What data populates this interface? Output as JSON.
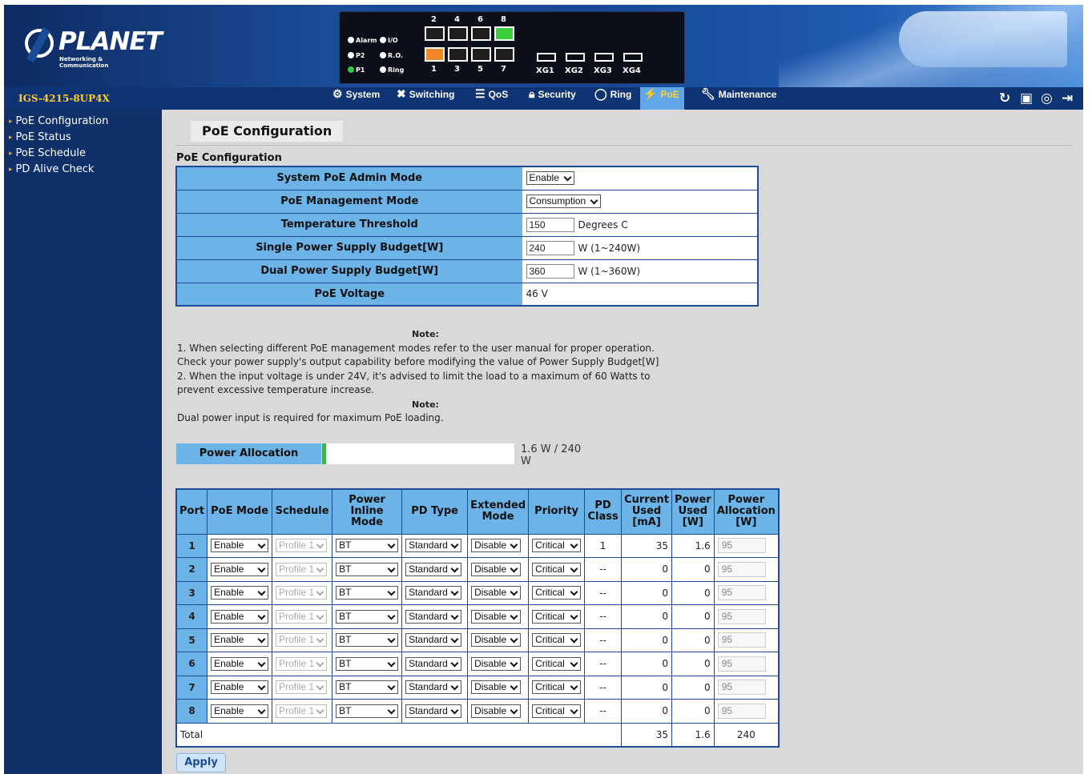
{
  "banner": {
    "brand": "PLANET",
    "tagline": "Networking & Communication",
    "panel": {
      "leds": [
        "Alarm",
        "I/O",
        "P2",
        "R.O.",
        "P1",
        "Ring"
      ],
      "top_port_numbers": [
        "2",
        "4",
        "6",
        "8"
      ],
      "bottom_port_numbers": [
        "1",
        "3",
        "5",
        "7"
      ],
      "sfp_ports": [
        "XG1",
        "XG2",
        "XG3",
        "XG4"
      ]
    }
  },
  "menubar": {
    "model": "IGS-4215-8UP4X",
    "items": [
      {
        "label": "System",
        "icon": "gear-icon"
      },
      {
        "label": "Switching",
        "icon": "switching-icon"
      },
      {
        "label": "QoS",
        "icon": "qos-icon"
      },
      {
        "label": "Security",
        "icon": "lock-icon"
      },
      {
        "label": "Ring",
        "icon": "ring-icon"
      },
      {
        "label": "PoE",
        "icon": "poe-icon",
        "active": true
      },
      {
        "label": "Maintenance",
        "icon": "wrench-icon"
      }
    ],
    "tools": [
      "refresh-icon",
      "save-icon",
      "help-icon",
      "logout-icon"
    ]
  },
  "sidebar": {
    "items": [
      "PoE Configuration",
      "PoE Status",
      "PoE Schedule",
      "PD Alive Check"
    ]
  },
  "page": {
    "title": "PoE Configuration",
    "section": "PoE Configuration"
  },
  "config": {
    "admin_mode_label": "System PoE Admin Mode",
    "admin_mode_value": "Enable",
    "mgmt_mode_label": "PoE Management Mode",
    "mgmt_mode_value": "Consumption",
    "temp_label": "Temperature Threshold",
    "temp_value": "150",
    "temp_unit": "Degrees C",
    "single_label": "Single Power Supply Budget[W]",
    "single_value": "240",
    "single_unit": "W (1~240W)",
    "dual_label": "Dual Power Supply Budget[W]",
    "dual_value": "360",
    "dual_unit": "W (1~360W)",
    "voltage_label": "PoE Voltage",
    "voltage_value": "46 V"
  },
  "notes": {
    "note1_heading": "Note:",
    "note1_lines": [
      "1. When selecting different PoE management modes refer to the user manual for proper operation.",
      "Check your power supply's output capability before modifying the value of Power Supply Budget[W]",
      "2. When the input voltage is under 24V, it's advised to limit the load to a maximum of 60 Watts to",
      "prevent excessive temperature increase."
    ],
    "note2_heading": "Note:",
    "note2_line": "Dual power input is required for maximum PoE loading."
  },
  "power_allocation": {
    "label": "Power Allocation",
    "used_fraction": 0.0067,
    "text": "1.6 W / 240 W"
  },
  "ports_table": {
    "headers": {
      "port": "Port",
      "poe_mode": "PoE Mode",
      "schedule": "Schedule",
      "inline_mode": "Power Inline Mode",
      "pd_type": "PD Type",
      "extended": "Extended Mode",
      "priority": "Priority",
      "pd_class": "PD Class",
      "current": "Current Used [mA]",
      "power_used": "Power Used [W]",
      "allocation": "Power Allocation [W]"
    },
    "rows": [
      {
        "port": "1",
        "poe_mode": "Enable",
        "schedule": "Profile 1",
        "inline_mode": "BT",
        "pd_type": "Standard",
        "extended": "Disable",
        "priority": "Critical",
        "pd_class": "1",
        "current": "35",
        "power": "1.6",
        "allocation": "95"
      },
      {
        "port": "2",
        "poe_mode": "Enable",
        "schedule": "Profile 1",
        "inline_mode": "BT",
        "pd_type": "Standard",
        "extended": "Disable",
        "priority": "Critical",
        "pd_class": "--",
        "current": "0",
        "power": "0",
        "allocation": "95"
      },
      {
        "port": "3",
        "poe_mode": "Enable",
        "schedule": "Profile 1",
        "inline_mode": "BT",
        "pd_type": "Standard",
        "extended": "Disable",
        "priority": "Critical",
        "pd_class": "--",
        "current": "0",
        "power": "0",
        "allocation": "95"
      },
      {
        "port": "4",
        "poe_mode": "Enable",
        "schedule": "Profile 1",
        "inline_mode": "BT",
        "pd_type": "Standard",
        "extended": "Disable",
        "priority": "Critical",
        "pd_class": "--",
        "current": "0",
        "power": "0",
        "allocation": "95"
      },
      {
        "port": "5",
        "poe_mode": "Enable",
        "schedule": "Profile 1",
        "inline_mode": "BT",
        "pd_type": "Standard",
        "extended": "Disable",
        "priority": "Critical",
        "pd_class": "--",
        "current": "0",
        "power": "0",
        "allocation": "95"
      },
      {
        "port": "6",
        "poe_mode": "Enable",
        "schedule": "Profile 1",
        "inline_mode": "BT",
        "pd_type": "Standard",
        "extended": "Disable",
        "priority": "Critical",
        "pd_class": "--",
        "current": "0",
        "power": "0",
        "allocation": "95"
      },
      {
        "port": "7",
        "poe_mode": "Enable",
        "schedule": "Profile 1",
        "inline_mode": "BT",
        "pd_type": "Standard",
        "extended": "Disable",
        "priority": "Critical",
        "pd_class": "--",
        "current": "0",
        "power": "0",
        "allocation": "95"
      },
      {
        "port": "8",
        "poe_mode": "Enable",
        "schedule": "Profile 1",
        "inline_mode": "BT",
        "pd_type": "Standard",
        "extended": "Disable",
        "priority": "Critical",
        "pd_class": "--",
        "current": "0",
        "power": "0",
        "allocation": "95"
      }
    ],
    "total": {
      "label": "Total",
      "current": "35",
      "power": "1.6",
      "allocation": "240"
    }
  },
  "apply_label": "Apply",
  "colors": {
    "accent": "#6cb3e8",
    "nav": "#0f3474",
    "model": "#ffcc33",
    "bar_fill": "#3fb34f"
  }
}
